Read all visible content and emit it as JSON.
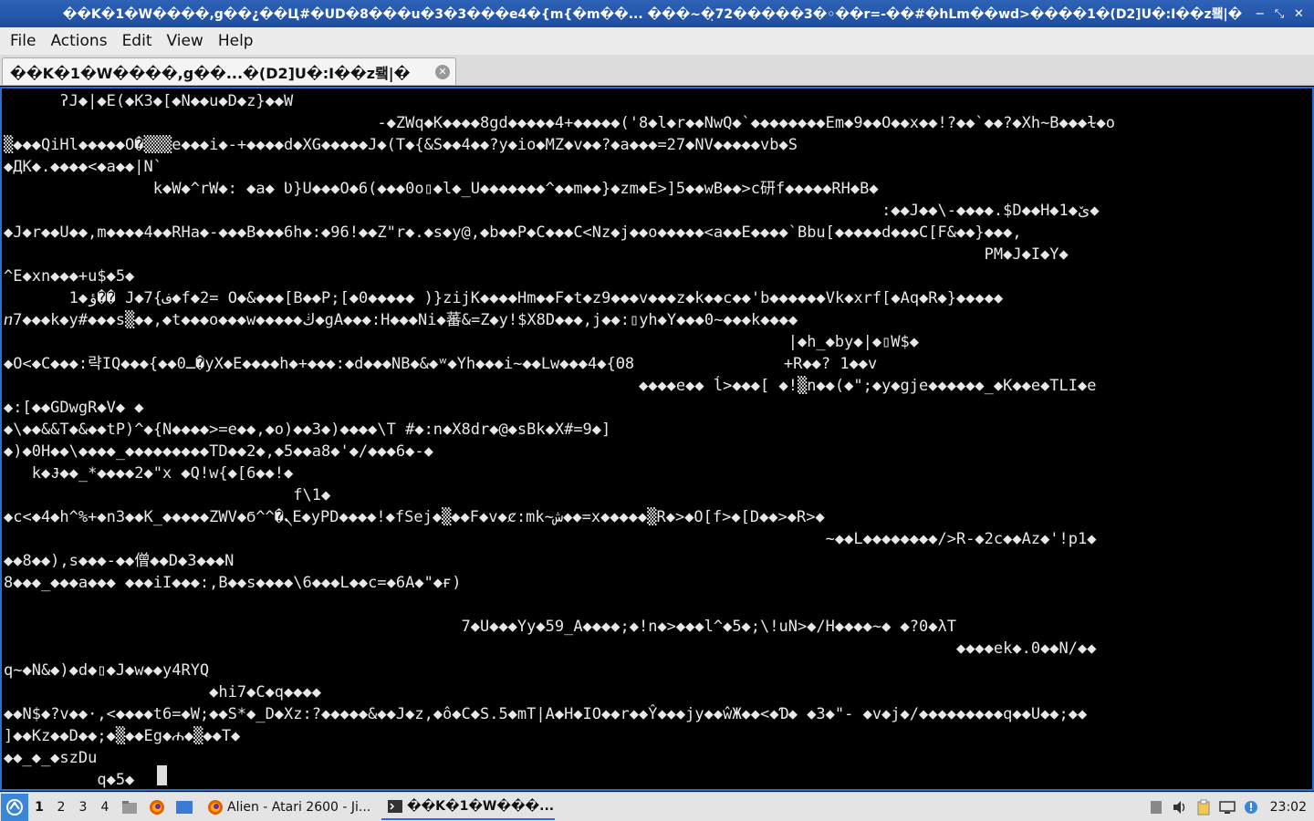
{
  "window": {
    "title": "��K�1�W����,g��¿��Ц#�UD�8���u�3�3���e4�{m{�m��... ���~�ͅ72�����3�◦��r=-��#�hLm��wd>����1�(D2]U�:I��z뢬|�",
    "minimize_icon": "−",
    "restore_icon": "⤡",
    "close_icon": "✕"
  },
  "menu": [
    "File",
    "Actions",
    "Edit",
    "View",
    "Help"
  ],
  "tab": {
    "label": "��K�1�W����,g��...�(D2]U�:I��z뢬|�",
    "close_icon": "✕"
  },
  "terminal": {
    "lines": [
      "      ʔJ◆|◆E(◆K3◆[◆N◆◆u◆D◆z}◆◆W",
      "                                        -◆ZWq◆K◆◆◆◆8gd◆◆◆◆◆4+◆◆◆◆◆('8◆l◆r◆◆NwQ◆`◆◆◆◆◆◆◆◆Em◆9◆◆O◆◆x◆◆!?◆◆`◆◆?◆Xh~B◆◆◆ɫ◆o",
      "▒◆◆◆QiHl◆◆◆◆◆O�▒▒▒e◆◆◆i◆-+◆◆◆◆d◆XG◆◆◆◆◆J◆(T◆{&S◆◆4◆◆?y◆io◆MZ◆v◆◆?◆a◆◆◆=27◆NV◆◆◆◆◆vb◆S",
      "◆ДК◆.◆◆◆◆<◆a◆◆|N`",
      "                k◆W◆^rW◆: ◆a◆ Ʋ}U◆◆◆O◆6(◆◆◆0o▯◆l◆_U◆◆◆◆◆◆◆^◆◆m◆◆}◆zm◆E>]5◆◆wB◆◆>c研f◆◆◆◆◆RH◆B◆",
      "                                                                                              :◆◆J◆◆\\-◆◆◆◆.$D◆◆H◆1◆ێ◆",
      "◆J◆r◆◆U◆◆,m◆◆◆◆4◆◆RHa◆-◆◆◆B◆◆◆6h◆:◆96!◆◆Z\"r◆.◆s◆y@,◆b◆◆P◆C◆◆◆C<Nz◆j◆◆o◆◆◆◆◆<a◆◆E◆◆◆◆`Bbu[◆◆◆◆◆d◆◆◆C[F&◆◆}◆◆◆,",
      "                                                                                                         PM◆J◆I◆Y◆",
      "^E◆xn◆◆◆+u$◆5◆",
      "       1◆ؤ�� J◆7{ف◆f◆2= O◆&◆◆◆[B◆◆P;[◆0◆◆◆◆◆ )}zijK◆◆◆◆Hm◆◆F◆t◆z9◆◆◆v◆◆◆z◆k◆◆c◆◆'b◆◆◆◆◆◆Vk◆xrf[◆Aq◆R◆}◆◆◆◆◆",
      "ⴖ7◆◆◆k◆y#◆◆◆s▒◆◆,◆t◆◆◆o◆◆◆w◆◆◆◆◆ڬ◆gA◆◆◆:H◆◆◆Ni◆蕃&=Z◆y!$X8D◆◆◆,j◆◆:▯yh◆Y◆◆◆0~◆◆◆k◆◆◆◆",
      "                                                                                    |◆h_◆by◆|◆▯W$◆",
      "◆O<◆C◆◆◆:략IQ◆◆◆{◆◆0ـ�yX◆E◆◆◆◆h◆+◆◆◆:◆d◆◆◆NB◆&◆ʷ◆Yh◆◆◆i~◆◆Lw◆◆◆4◆{Θ8                +R◆◆? 1◆◆v",
      "                                                                    ◆◆◆◆e◆◆ ĺ>◆◆◆[ ◆!▒n◆◆(◆\";◆y◆gje◆◆◆◆◆◆_◆K◆◆e◆TLI◆e",
      "◆:[◆◆GDwgR◆V◆ ◆",
      "◆\\◆◆&&T◆&◆◆tP)^◆{N◆◆◆◆>=e◆◆,◆o)◆◆3◆)◆◆◆◆\\T #◆:n◆X8dr◆@◆sBk◆X#=9◆]",
      "◆)◆0H◆◆\\◆◆◆◆_◆◆◆◆◆◆◆◆◆TD◆◆2◆,◆5◆◆a8◆'◆/◆◆◆6◆-◆",
      "   k◆Ɉ◆◆_*◆◆◆◆2◆\"x ◆Q!w{◆[6◆◆!◆",
      "                               f\\1◆",
      "◆c<◆4◆h^%+◆n3◆◆K_◆◆◆◆◆ZWV◆Ϭ^^�ܢE◆yPD◆◆◆◆!◆fSej◆▒◆◆F◆v◆ȼ:mk~ش◆◆=x◆◆◆◆◆▒R◆>◆O[f>◆[D◆◆>◆R>◆",
      "                                                                                        ~◆◆L◆◆◆◆◆◆◆◆/>R-◆2c◆◆Az◆'!p1◆",
      "◆◆8◆◆),s◆◆◆-◆◆僧◆◆D◆3◆◆◆N",
      "8◆◆◆_◆◆◆a◆◆◆ ◆◆◆iI◆◆◆:,B◆◆s◆◆◆◆\\6◆◆◆L◆◆c=◆6A◆\"◆ғ)",
      "",
      "                                                 7◆U◆◆◆Yy◆59_A◆◆◆◆;◆!n◆>◆◆◆l^◆5◆;\\!uN>◆/H◆◆◆◆~◆ ◆?0◆λT",
      "                                                                                                      ◆◆◆◆ek◆.0◆◆N/◆◆",
      "q~◆N&◆)◆d◆▯◆J◆w◆◆y4RYQ",
      "                      ◆hi7◆C◆q◆◆◆◆",
      "◆◆N$◆?v◆◆·,<◆◆◆◆t6=◆W;◆◆S*◆_D◆Xz:?◆◆◆◆◆&◆◆J◆z,◆ô◆C◆S.5◆mT|A◆H◆IO◆◆r◆◆Ŷ◆◆◆jy◆◆ŵЖ◆◆<◆Ɗ◆ ◆3◆\"- ◆v◆j◆/◆◆◆◆◆◆◆◆◆q◆◆U◆◆;◆◆",
      "]◆◆Kz◆◆D◆◆;◆▒◆◆Eg◆ሐ◆▒◆◆T◆",
      "◆◆_◆_◆szDu",
      "          q◆5◆"
    ]
  },
  "taskbar": {
    "workspaces": [
      "1",
      "2",
      "3",
      "4"
    ],
    "tasks": [
      {
        "label": "Alien - Atari 2600 - Ji..."
      },
      {
        "label": "��K�1�W���..."
      }
    ],
    "clock": "23:02"
  },
  "colors": {
    "titlebar": "#1e4d9e",
    "terminal_border": "#2b6fd3",
    "terminal_bg": "#000000",
    "terminal_fg": "#e8e8e8"
  }
}
